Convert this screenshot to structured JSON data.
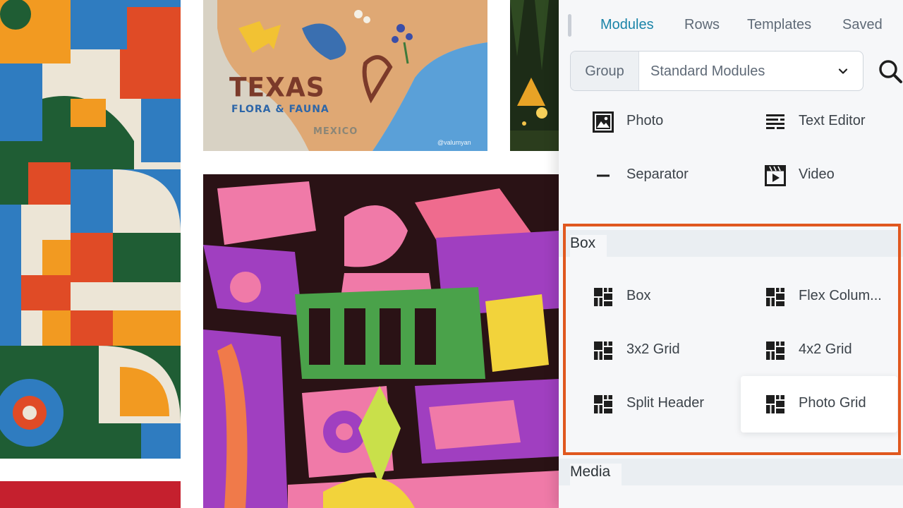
{
  "canvas": {
    "map_art": {
      "title": "TEXAS",
      "subtitle": "FLORA & FAUNA",
      "country_label": "MEXICO",
      "credit": "@valumyan"
    }
  },
  "panel": {
    "tabs": [
      {
        "label": "Modules",
        "active": true
      },
      {
        "label": "Rows",
        "active": false
      },
      {
        "label": "Templates",
        "active": false
      },
      {
        "label": "Saved",
        "active": false
      }
    ],
    "group_select": {
      "label": "Group",
      "value": "Standard Modules"
    },
    "standard_modules": [
      {
        "label": "Photo",
        "icon": "photo-icon"
      },
      {
        "label": "Text Editor",
        "icon": "text-editor-icon"
      },
      {
        "label": "Separator",
        "icon": "separator-icon"
      },
      {
        "label": "Video",
        "icon": "video-icon"
      }
    ],
    "box_section": {
      "title": "Box",
      "items": [
        {
          "label": "Box",
          "icon": "box-layout-icon"
        },
        {
          "label": "Flex Colum...",
          "icon": "box-layout-icon"
        },
        {
          "label": "3x2 Grid",
          "icon": "box-layout-icon"
        },
        {
          "label": "4x2 Grid",
          "icon": "box-layout-icon"
        },
        {
          "label": "Split Header",
          "icon": "box-layout-icon"
        },
        {
          "label": "Photo Grid",
          "icon": "box-layout-icon",
          "hovered": true
        }
      ]
    },
    "media_section": {
      "title": "Media"
    }
  },
  "colors": {
    "accent_tab": "#1a84a8",
    "highlight_border": "#e0581f",
    "panel_bg": "#f6f7f9"
  }
}
